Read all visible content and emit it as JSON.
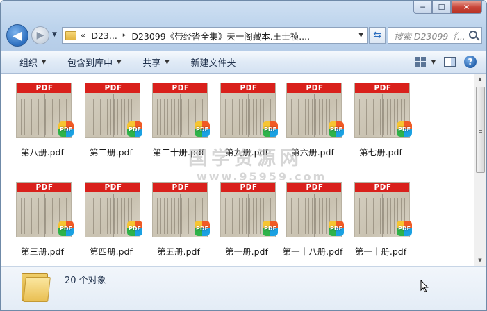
{
  "window": {
    "minimize_glyph": "─",
    "maximize_glyph": "☐",
    "close_glyph": "✕"
  },
  "nav": {
    "back_glyph": "◀",
    "forward_glyph": "▶",
    "history_glyph": "▼",
    "breadcrumb": [
      "D23...",
      "D23099《带经沓全集》天一阁藏本.王士祯...."
    ],
    "breadcrumb_lead": "«",
    "breadcrumb_sep": "▸",
    "address_dropdown_glyph": "▼",
    "refresh_glyph": "⇆",
    "search_placeholder": "搜索 D23099《..."
  },
  "toolbar": {
    "organize": "组织",
    "include_in_library": "包含到库中",
    "share": "共享",
    "new_folder": "新建文件夹",
    "caret": "▼",
    "help": "?"
  },
  "files": [
    {
      "name": "第八册.pdf",
      "band": "PDF",
      "badge": "PDF"
    },
    {
      "name": "第二册.pdf",
      "band": "PDF",
      "badge": "PDF"
    },
    {
      "name": "第二十册.pdf",
      "band": "PDF",
      "badge": "PDF"
    },
    {
      "name": "第九册.pdf",
      "band": "PDF",
      "badge": "PDF"
    },
    {
      "name": "第六册.pdf",
      "band": "PDF",
      "badge": "PDF"
    },
    {
      "name": "第七册.pdf",
      "band": "PDF",
      "badge": "PDF"
    },
    {
      "name": "第三册.pdf",
      "band": "PDF",
      "badge": "PDF"
    },
    {
      "name": "第四册.pdf",
      "band": "PDF",
      "badge": "PDF"
    },
    {
      "name": "第五册.pdf",
      "band": "PDF",
      "badge": "PDF"
    },
    {
      "name": "第一册.pdf",
      "band": "PDF",
      "badge": "PDF"
    },
    {
      "name": "第一十八册.pdf",
      "band": "PDF",
      "badge": "PDF"
    },
    {
      "name": "第一十册.pdf",
      "band": "PDF",
      "badge": "PDF"
    }
  ],
  "watermark": {
    "title": "国学资源网",
    "url": "www.95959.com"
  },
  "scrollbar": {
    "up_glyph": "▲",
    "down_glyph": "▼"
  },
  "status": {
    "count": "20 个对象"
  }
}
